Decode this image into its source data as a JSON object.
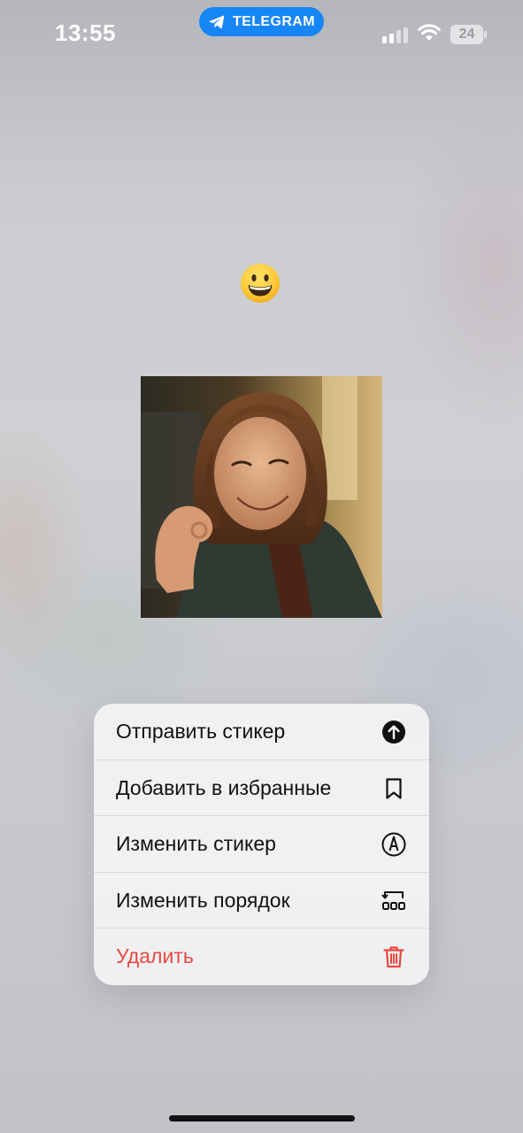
{
  "status_bar": {
    "time": "13:55",
    "app_pill_label": "TELEGRAM",
    "battery_level": "24",
    "icons": [
      "telegram-plane-icon",
      "cellular-signal-icon",
      "wifi-icon",
      "battery-icon"
    ]
  },
  "sticker_preview": {
    "emoji": "grinning-face-emoji",
    "image": "sticker-photo-smiling-woman-ok-gesture"
  },
  "context_menu": {
    "items": [
      {
        "label": "Отправить стикер",
        "icon": "send-arrow-up-icon"
      },
      {
        "label": "Добавить в избранные",
        "icon": "bookmark-icon"
      },
      {
        "label": "Изменить стикер",
        "icon": "edit-pen-circle-icon"
      },
      {
        "label": "Изменить порядок",
        "icon": "reorder-icon"
      },
      {
        "label": "Удалить",
        "icon": "trash-icon",
        "destructive": true,
        "color": "#e8483e"
      }
    ]
  },
  "colors": {
    "accent": "#1786f5",
    "destructive": "#e8483e",
    "menu_background": "#f2f2f4"
  }
}
